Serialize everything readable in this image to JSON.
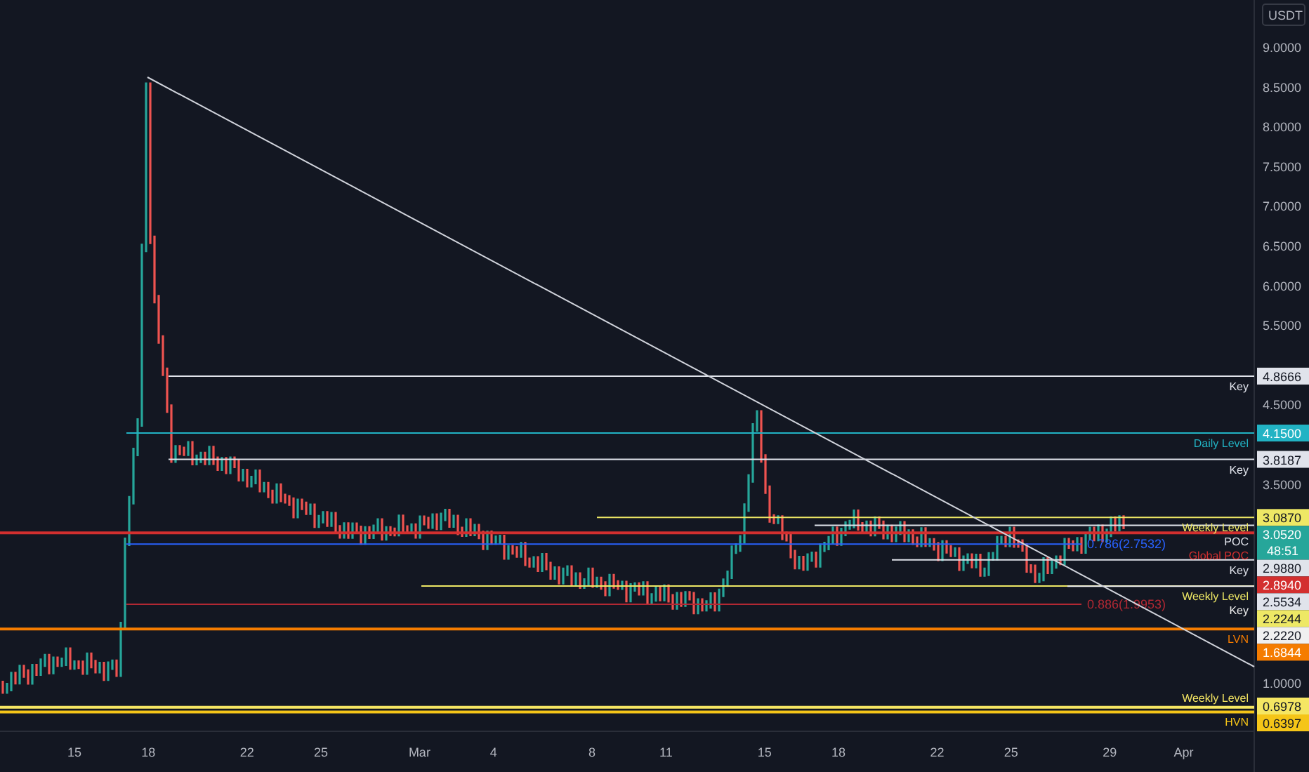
{
  "currency": "USDT",
  "price_axis": {
    "ticks": [
      "9.0000",
      "8.5000",
      "8.0000",
      "7.5000",
      "7.0000",
      "6.5000",
      "6.0000",
      "5.5000",
      "4.5000",
      "3.5000",
      "1.0000"
    ]
  },
  "time_axis": {
    "labels": [
      "15",
      "18",
      "22",
      "25",
      "Mar",
      "4",
      "8",
      "11",
      "15",
      "18",
      "22",
      "25",
      "29",
      "Apr"
    ]
  },
  "current_price": {
    "price": "3.0520",
    "countdown": "48:51"
  },
  "levels": [
    {
      "price": "4.8666",
      "text": "Key",
      "color": "#e0e3eb"
    },
    {
      "price": "4.1500",
      "text": "Daily Level",
      "color": "#22b3c4"
    },
    {
      "price": "3.8187",
      "text": "Key",
      "color": "#e0e3eb"
    },
    {
      "price": "3.0870",
      "text": "Weekly Level",
      "color": "#eee865"
    },
    {
      "price": "2.9880",
      "text": "POC",
      "color": "#e0e3eb"
    },
    {
      "price": "2.8940",
      "text": "Global POC",
      "color": "#d32f2f"
    },
    {
      "price": "2.5534",
      "text": "Key",
      "color": "#e0e3eb"
    },
    {
      "price": "2.2244",
      "text": "Weekly Level",
      "color": "#eee865"
    },
    {
      "price": "2.2220",
      "text": "Key",
      "color": "#f0f0f0"
    },
    {
      "price": "1.6844",
      "text": "LVN",
      "color": "#f57c00"
    },
    {
      "price": "0.6978",
      "text": "Weekly Level",
      "color": "#f5e663"
    },
    {
      "price": "0.6397",
      "text": "HVN",
      "color": "#f5c518"
    }
  ],
  "fib_levels": [
    {
      "text": "0.786(2.7532)",
      "color": "#2962ff"
    },
    {
      "text": "0.886(1.9953)",
      "color": "#b22833"
    }
  ]
}
